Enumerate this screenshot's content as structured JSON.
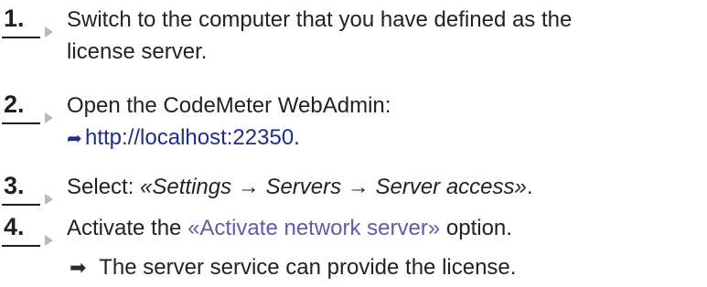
{
  "steps": [
    {
      "number": "1.",
      "line1": "Switch to the computer that you have defined as the",
      "line2": "license server."
    },
    {
      "number": "2.",
      "line1": "Open the CodeMeter WebAdmin:",
      "link_arrow": "➦",
      "link": "http://localhost:22350",
      "after_link": "."
    },
    {
      "number": "3.",
      "prefix": "Select: ",
      "menu_path": "«Settings → Servers → Server access»",
      "suffix": "."
    },
    {
      "number": "4.",
      "prefix": "Activate the ",
      "ui_label": "«Activate network server»",
      "suffix": " option."
    }
  ],
  "result": {
    "arrow": "➡",
    "text": "The server service can provide the license."
  },
  "colors": {
    "text": "#222222",
    "link": "#1f2d8b",
    "ui_label": "#5e5ca8",
    "step_marker": "#b8b8b8"
  }
}
